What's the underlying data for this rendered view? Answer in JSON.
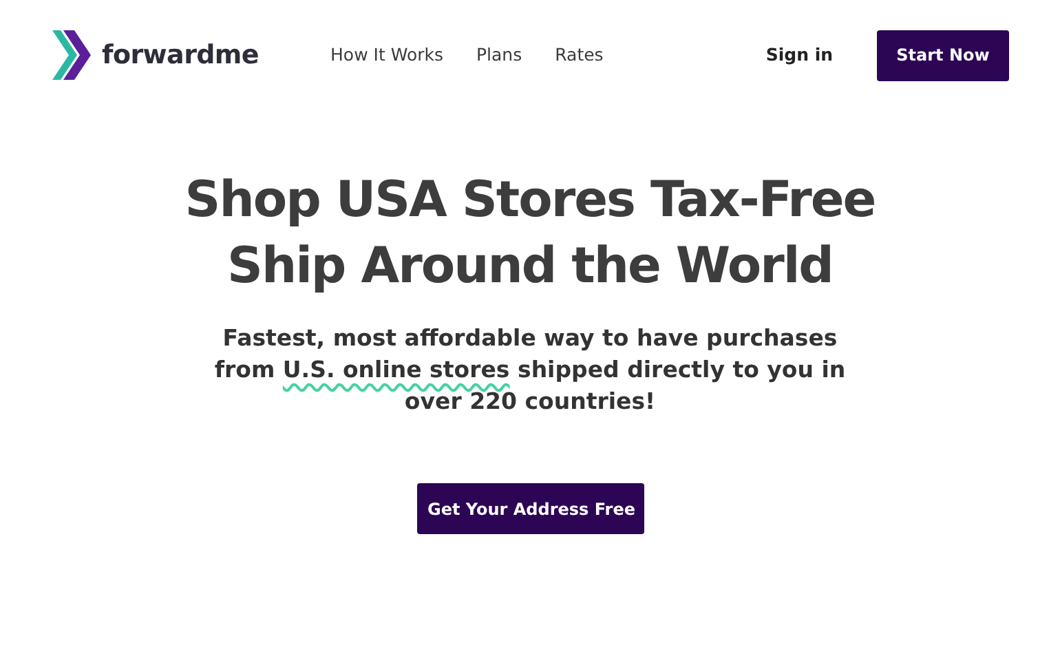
{
  "navbar": {
    "brand": "forwardme",
    "links": [
      "How It Works",
      "Plans",
      "Rates"
    ],
    "sign_in": "Sign in",
    "cta": "Start Now"
  },
  "hero": {
    "title_lines": [
      "Shop USA Stores Tax-Free",
      "Ship Around the World"
    ],
    "subtitle": {
      "before": "Fastest, most affordable way to have purchases from ",
      "highlight": "U.S. online stores",
      "after": " shipped directly to you in over 220 countries!"
    },
    "button": "Get Your Address Free"
  }
}
